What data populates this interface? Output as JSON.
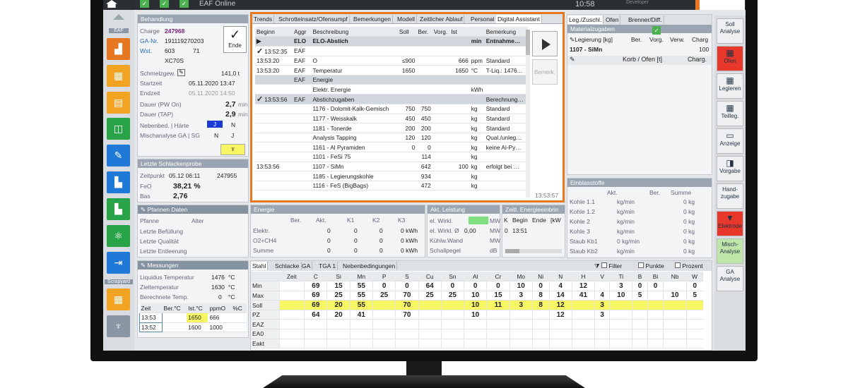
{
  "topbar": {
    "title": "EAF Online",
    "time": "10:58",
    "user": "Developer",
    "checks": [
      "✓",
      "✓",
      "✓"
    ]
  },
  "sidebar": {
    "labels": {
      "eaf": "EAF",
      "scrapyard": "Scrapyard"
    }
  },
  "behandlung": {
    "header": "Behandlung",
    "charge_label": "Charge",
    "charge": "247968",
    "ganr_label": "GA-Nr.",
    "ganr": "191119270203",
    "wst_label": "Wst.",
    "wst": "603",
    "wst2": "71",
    "grade": "XC70S",
    "ende": "Ende",
    "schmelz_label": "Schmelzgew.",
    "schmelz": "141,0 t",
    "start_label": "Startzeit",
    "start": "05.11.2020 13:47",
    "end_label": "Endzeit",
    "end": "05.11.2020 14:50",
    "pwon_label": "Dauer (PW On)",
    "pwon": "2,7",
    "pwon_unit": "min",
    "tap_label": "Dauer (TAP)",
    "tap": "2,9",
    "tap_unit": "min",
    "neben_label": "Nebenbed. | Härte",
    "neben_j": "J",
    "neben_n": "N",
    "misch_label": "Mischanalyse GA | SG",
    "misch_n": "N",
    "misch_j": "J"
  },
  "schlacke": {
    "header": "Letzte Schlackenprobe",
    "zeit_label": "Zeitpunkt",
    "zeit": "05.12 06:11",
    "nr": "247955",
    "feo_label": "FeO",
    "feo": "38,21 %",
    "bas_label": "Bas",
    "bas": "2,76"
  },
  "pfannen": {
    "header": "Pfannen Daten",
    "pfanne": "Pfanne",
    "alter": "Alter",
    "bef": "Letzte Befüllung",
    "qual": "Letzte Qualität",
    "entl": "Letzte Entleerung"
  },
  "messungen": {
    "header": "Messungen",
    "liq_label": "Liquidus Temperatur",
    "liq": "1476",
    "liq_unit": "°C",
    "ziel_label": "Zieltemperatur",
    "ziel": "1630",
    "ziel_unit": "°C",
    "ber_label": "Berechnete Temp.",
    "ber": "0",
    "ber_unit": "°C",
    "cols": [
      "Zeit",
      "Ber.°C",
      "Ist.°C",
      "ppmO",
      "%C"
    ],
    "rows": [
      [
        "13:53",
        "",
        "1650",
        "666",
        ""
      ],
      [
        "13:52",
        "",
        "1600",
        "1000",
        ""
      ]
    ]
  },
  "tabs": [
    "Trends",
    "Schrotteinsatz/Ofensumpf",
    "Bemerkungen",
    "Modell",
    "Zeitlicher Ablauf",
    "Personal",
    "Digital Assistant"
  ],
  "da": {
    "cols": [
      "Beginn",
      "Aggr",
      "Beschreibung",
      "Soll",
      "Ber.",
      "Vorg.",
      "Ist",
      "",
      "Bemerkung"
    ],
    "rows": [
      {
        "b": "",
        "a": "ELO",
        "d": "ELO-Abstich",
        "s": "",
        "be": "",
        "v": "",
        "i": "",
        "u": "min",
        "r": "Entnahme…",
        "type": "sec"
      },
      {
        "b": "13:52:35",
        "a": "EAF",
        "d": "",
        "s": "",
        "be": "",
        "v": "",
        "i": "",
        "u": "",
        "r": "",
        "type": "chk"
      },
      {
        "b": "13:53:20",
        "a": "EAF",
        "d": "O",
        "s": "≤900",
        "be": "",
        "v": "",
        "i": "666",
        "u": "ppm",
        "r": "Standard",
        "type": ""
      },
      {
        "b": "13:53:20",
        "a": "EAF",
        "d": "Temperatur",
        "s": "1650",
        "be": "",
        "v": "",
        "i": "1650",
        "u": "°C",
        "r": "T-Liq.: 1476…",
        "type": ""
      },
      {
        "b": "",
        "a": "EAF",
        "d": "Energie",
        "s": "",
        "be": "",
        "v": "",
        "i": "",
        "u": "",
        "r": "",
        "type": "sec"
      },
      {
        "b": "",
        "a": "",
        "d": "Elektr. Energie",
        "s": "",
        "be": "",
        "v": "",
        "i": "",
        "u": "kWh",
        "r": "",
        "type": ""
      },
      {
        "b": "13:53:56",
        "a": "EAF",
        "d": "Abstichzugaben",
        "s": "",
        "be": "",
        "v": "",
        "i": "",
        "u": "",
        "r": "Berechnung…",
        "type": "secchk"
      },
      {
        "b": "",
        "a": "",
        "d": "1176 - Dolomit-Kalk-Gemisch",
        "s": "750",
        "be": "750",
        "v": "",
        "i": "",
        "u": "kg",
        "r": "Standard",
        "type": ""
      },
      {
        "b": "",
        "a": "",
        "d": "1177 - Weisskalk",
        "s": "450",
        "be": "450",
        "v": "",
        "i": "",
        "u": "kg",
        "r": "Standard",
        "type": ""
      },
      {
        "b": "",
        "a": "",
        "d": "1181 - Tonerde",
        "s": "200",
        "be": "200",
        "v": "",
        "i": "",
        "u": "kg",
        "r": "Standard",
        "type": ""
      },
      {
        "b": "",
        "a": "",
        "d": "Analysis Tapping",
        "s": "120",
        "be": "120",
        "v": "",
        "i": "",
        "u": "kg",
        "r": "Qual./unleg…",
        "type": ""
      },
      {
        "b": "",
        "a": "",
        "d": "1161 - Al Pyramiden",
        "s": "0",
        "be": "0",
        "v": "",
        "i": "",
        "u": "kg",
        "r": "keine Al-Py…",
        "type": ""
      },
      {
        "b": "",
        "a": "",
        "d": "1101 - FeSi 75",
        "s": "",
        "be": "114",
        "v": "",
        "i": "",
        "u": "kg",
        "r": "",
        "type": ""
      },
      {
        "b": "13:53:56",
        "a": "",
        "d": "1107 - SiMn",
        "s": "",
        "be": "642",
        "v": "",
        "i": "100",
        "u": "kg",
        "r": "erfolgt bei …",
        "type": ""
      },
      {
        "b": "",
        "a": "",
        "d": "1185 - Legierungskohle",
        "s": "",
        "be": "934",
        "v": "",
        "i": "",
        "u": "kg",
        "r": "",
        "type": ""
      },
      {
        "b": "",
        "a": "",
        "d": "1116 - FeS (BigBags)",
        "s": "",
        "be": "472",
        "v": "",
        "i": "",
        "u": "kg",
        "r": "",
        "type": ""
      }
    ],
    "bemerk_btn": "Bemerk.",
    "time": "13:53:57"
  },
  "leg": {
    "tabs": [
      "Leg./Zuschl.",
      "Ofen",
      "Brenner/Diff."
    ],
    "mat_header": "Materialzugaben",
    "cols": [
      "Legierung [kg]",
      "Ber.",
      "Vorg.",
      "Verw.",
      "Charg"
    ],
    "row": [
      "1107 - SiMn",
      "",
      "",
      "",
      "100"
    ],
    "korb": "Korb / Ofen [t]",
    "korb_charg": "Charg."
  },
  "einblas": {
    "header": "Einblasstoffe",
    "cols": [
      "Akt.",
      "Ber.",
      "Summe"
    ],
    "rows": [
      [
        "Kohle 1.1",
        "kg/min",
        "0 kg"
      ],
      [
        "Kohle 1.2",
        "kg/min",
        "0 kg"
      ],
      [
        "Kohle 2",
        "kg/min",
        "0 kg"
      ],
      [
        "Kohle 3",
        "kg/min",
        "0 kg"
      ],
      [
        "Staub Kb1",
        "0 kg/min",
        "0 kg"
      ],
      [
        "Staub Kb2",
        "kg/min",
        "0 kg"
      ]
    ]
  },
  "energie": {
    "header": "Energie",
    "cols": [
      "Ber.",
      "Akt.",
      "K1",
      "K2",
      "K3"
    ],
    "rows": [
      [
        "Elektr.",
        "",
        "0",
        "0",
        "0",
        "0 kWh"
      ],
      [
        "O2+CH4",
        "",
        "0",
        "0",
        "0",
        "0 kWh"
      ],
      [
        "Summe",
        "",
        "0",
        "0",
        "0",
        "0 kWh"
      ]
    ]
  },
  "leistung": {
    "header": "Akt. Leistung",
    "rows": [
      [
        "el. Wirkl.",
        "",
        "MW"
      ],
      [
        "el. Wirkl. Ø",
        "0,00",
        "MW"
      ],
      [
        "Kühlw.Wand",
        "",
        "MW"
      ],
      [
        "Schallpegel",
        "",
        "dB"
      ]
    ]
  },
  "zeitl": {
    "header": "Zeitl. Energieeinbrin",
    "cols": [
      "K",
      "Begin",
      "Ende",
      "[kW"
    ],
    "row": [
      "0",
      "13:51",
      "",
      ""
    ]
  },
  "analysis": {
    "tabs": [
      "Stahl",
      "Schlacke",
      "GA",
      "TGA 1",
      "Nebenbedingungen"
    ],
    "filter": "Filter",
    "punkte": "Punkte",
    "prozent": "Prozent",
    "cols": [
      "Zeit",
      "C",
      "Si",
      "Mn",
      "P",
      "S",
      "Cu",
      "Sn",
      "Al",
      "Cr",
      "Mo",
      "Ni",
      "N",
      "H",
      "V",
      "Ti",
      "B",
      "Bi",
      "Nb",
      "W"
    ],
    "rows": [
      {
        "l": "Min",
        "v": [
          "",
          "69",
          "15",
          "55",
          "0",
          "0",
          "64",
          "0",
          "0",
          "0",
          "10",
          "0",
          "4",
          "12",
          "",
          "3",
          "0",
          "0",
          "",
          "0",
          "0"
        ]
      },
      {
        "l": "Max",
        "v": [
          "",
          "69",
          "25",
          "55",
          "25",
          "70",
          "25",
          "25",
          "10",
          "15",
          "3",
          "8",
          "14",
          "41",
          "4",
          "10",
          "5",
          "",
          "10",
          "5"
        ]
      },
      {
        "l": "Soll",
        "v": [
          "",
          "69",
          "20",
          "55",
          "",
          "70",
          "",
          "",
          "10",
          "11",
          "3",
          "8",
          "12",
          "",
          "3",
          "",
          "",
          "",
          "",
          ""
        ],
        "hl": true
      },
      {
        "l": "PZ",
        "v": [
          "",
          "64",
          "20",
          "41",
          "",
          "70",
          "",
          "",
          "10",
          "",
          "",
          "",
          "12",
          "",
          "3",
          "",
          "",
          "",
          "",
          ""
        ]
      },
      {
        "l": "EAZ",
        "v": []
      },
      {
        "l": "EA0",
        "v": []
      },
      {
        "l": "Eakt",
        "v": []
      }
    ]
  },
  "rightbar": {
    "items": [
      "Soll Analyse",
      "Ofen",
      "Legieren",
      "Teilleg.",
      "Anzeige",
      "Vorgabe",
      "Hand-zugabe",
      "Elektrode",
      "Misch-Analyse",
      "GA Analyse"
    ]
  }
}
